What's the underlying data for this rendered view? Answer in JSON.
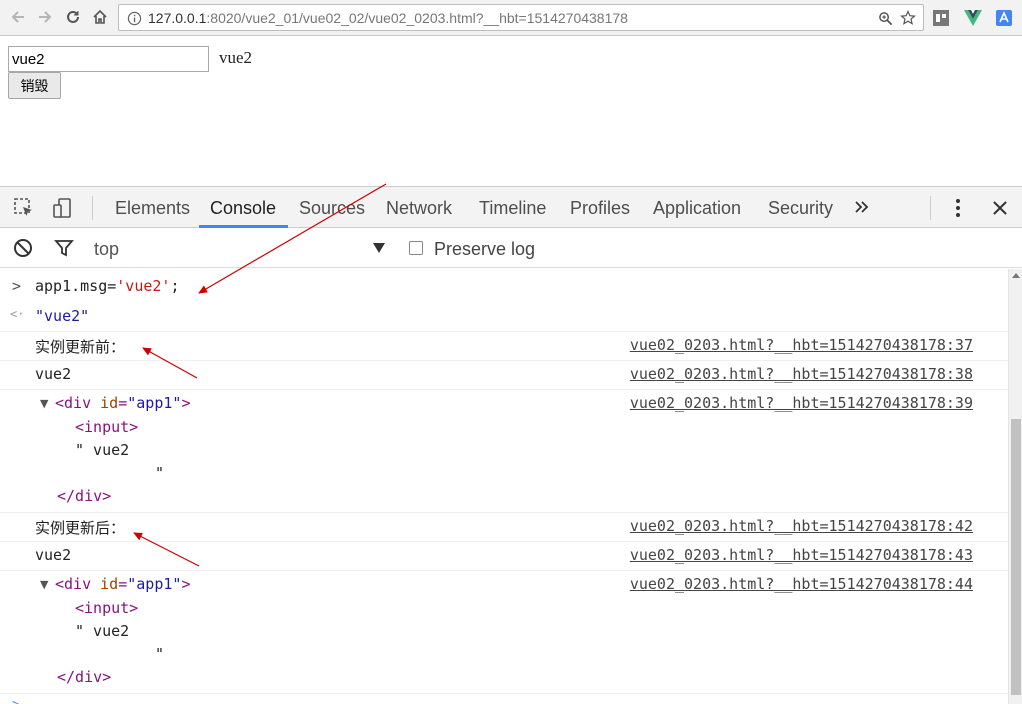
{
  "browser": {
    "url_prefix": "127.0.0.1",
    "url_rest": ":8020/vue2_01/vue02_02/vue02_0203.html?__hbt=1514270438178",
    "icons": [
      "back-icon",
      "forward-icon",
      "reload-icon",
      "home-icon",
      "info-icon",
      "zoom-icon",
      "star-icon",
      "extension-icon",
      "vue-devtools-icon",
      "translate-icon",
      "menu-icon"
    ]
  },
  "page": {
    "input_value": "vue2",
    "bound_text": "vue2",
    "destroy_label": "销毁"
  },
  "devtools": {
    "tabs": [
      "Elements",
      "Console",
      "Sources",
      "Network",
      "Timeline",
      "Profiles",
      "Application",
      "Security"
    ],
    "active_tab": "Console",
    "context": "top",
    "preserve_log_label": "Preserve log"
  },
  "console": {
    "input": {
      "prompt": ">",
      "code_prefix": "app1.msg=",
      "code_string": "'vue2'",
      "code_suffix": ";"
    },
    "result": {
      "prompt": "<·",
      "value": "\"vue2\""
    },
    "logs": [
      {
        "text": "实例更新前：",
        "source": "vue02_0203.html?__hbt=1514270438178:37"
      },
      {
        "text": "vue2",
        "source": "vue02_0203.html?__hbt=1514270438178:38"
      },
      {
        "source": "vue02_0203.html?__hbt=1514270438178:39",
        "open_tag": "<div",
        "attr_name": "id",
        "attr_value": "\"app1\"",
        "close_bracket": ">",
        "child_tag": "<input>",
        "child_text": "\" vue2",
        "quote": "\"",
        "end_tag": "</div>"
      },
      {
        "text": "实例更新后：",
        "source": "vue02_0203.html?__hbt=1514270438178:42"
      },
      {
        "text": "vue2",
        "source": "vue02_0203.html?__hbt=1514270438178:43"
      },
      {
        "source": "vue02_0203.html?__hbt=1514270438178:44",
        "open_tag": "<div",
        "attr_name": "id",
        "attr_value": "\"app1\"",
        "close_bracket": ">",
        "child_tag": "<input>",
        "child_text": "\" vue2",
        "quote": "\"",
        "end_tag": "</div>"
      }
    ]
  },
  "colors": {
    "accent": "#4285f4",
    "annotation": "#cc0000",
    "string": "#c41a16",
    "tag": "#881280"
  }
}
